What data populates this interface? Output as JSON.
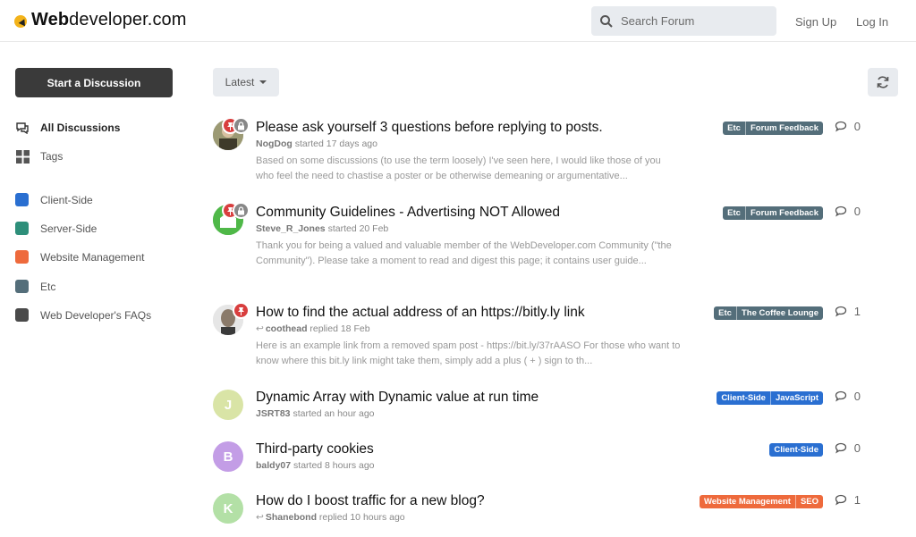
{
  "header": {
    "logo_bold": "Web",
    "logo_rest": "developer.com",
    "search_placeholder": "Search Forum",
    "sign_up": "Sign Up",
    "log_in": "Log In"
  },
  "sidebar": {
    "start_button": "Start a Discussion",
    "nav": [
      {
        "label": "All Discussions",
        "icon": "chat-icon"
      },
      {
        "label": "Tags",
        "icon": "grid-icon"
      }
    ],
    "tags": [
      {
        "label": "Client-Side",
        "color": "#2a6fd1"
      },
      {
        "label": "Server-Side",
        "color": "#2e8f7a"
      },
      {
        "label": "Website Management",
        "color": "#ee6a3c"
      },
      {
        "label": "Etc",
        "color": "#546e7a"
      },
      {
        "label": "Web Developer's FAQs",
        "color": "#4a4a4a"
      }
    ]
  },
  "toolbar": {
    "sort_label": "Latest"
  },
  "discussions": [
    {
      "title": "Please ask yourself 3 questions before replying to posts.",
      "author": "NogDog",
      "action": "started 17 days ago",
      "excerpt": "Based on some discussions (to use the term loosely) I've seen here, I would like those of you who feel the need to chastise a poster or be otherwise demeaning or argumentative...",
      "tags": [
        {
          "label": "Etc",
          "color": "#546e7a"
        },
        {
          "label": "Forum Feedback",
          "color": "#546e7a"
        }
      ],
      "count": "0"
    },
    {
      "title": "Community Guidelines - Advertising NOT Allowed",
      "author": "Steve_R_Jones",
      "action": "started 20 Feb",
      "excerpt": "Thank you for being a valued and valuable member of the WebDeveloper.com Community (\"the Community\"). Please take a moment to read and digest this page; it contains user guide...",
      "tags": [
        {
          "label": "Etc",
          "color": "#546e7a"
        },
        {
          "label": "Forum Feedback",
          "color": "#546e7a"
        }
      ],
      "count": "0"
    },
    {
      "title": "How to find the actual address of an https://bitly.ly link",
      "author": "coothead",
      "action": "replied 18 Feb",
      "excerpt": "Here is an example link from a removed spam post - https://bit.ly/37rAASO For those who want to know where this bit.ly link might take them, simply add a plus ( + ) sign to th...",
      "tags": [
        {
          "label": "Etc",
          "color": "#546e7a"
        },
        {
          "label": "The Coffee Lounge",
          "color": "#546e7a"
        }
      ],
      "count": "1"
    },
    {
      "title": "Dynamic Array with Dynamic value at run time",
      "author": "JSRT83",
      "action": "started an hour ago",
      "avatar_letter": "J",
      "avatar_color": "#d9e4a6",
      "tags": [
        {
          "label": "Client-Side",
          "color": "#2a6fd1"
        },
        {
          "label": "JavaScript",
          "color": "#2a6fd1"
        }
      ],
      "count": "0"
    },
    {
      "title": "Third-party cookies",
      "author": "baldy07",
      "action": "started 8 hours ago",
      "avatar_letter": "B",
      "avatar_color": "#c39de6",
      "tags": [
        {
          "label": "Client-Side",
          "color": "#2a6fd1"
        }
      ],
      "count": "0"
    },
    {
      "title": "How do I boost traffic for a new blog?",
      "author": "Shanebond",
      "action": "replied 10 hours ago",
      "avatar_letter": "K",
      "avatar_color": "#b3e0a6",
      "tags": [
        {
          "label": "Website Management",
          "color": "#ee6a3c"
        },
        {
          "label": "SEO",
          "color": "#ee6a3c"
        }
      ],
      "count": "1"
    }
  ]
}
